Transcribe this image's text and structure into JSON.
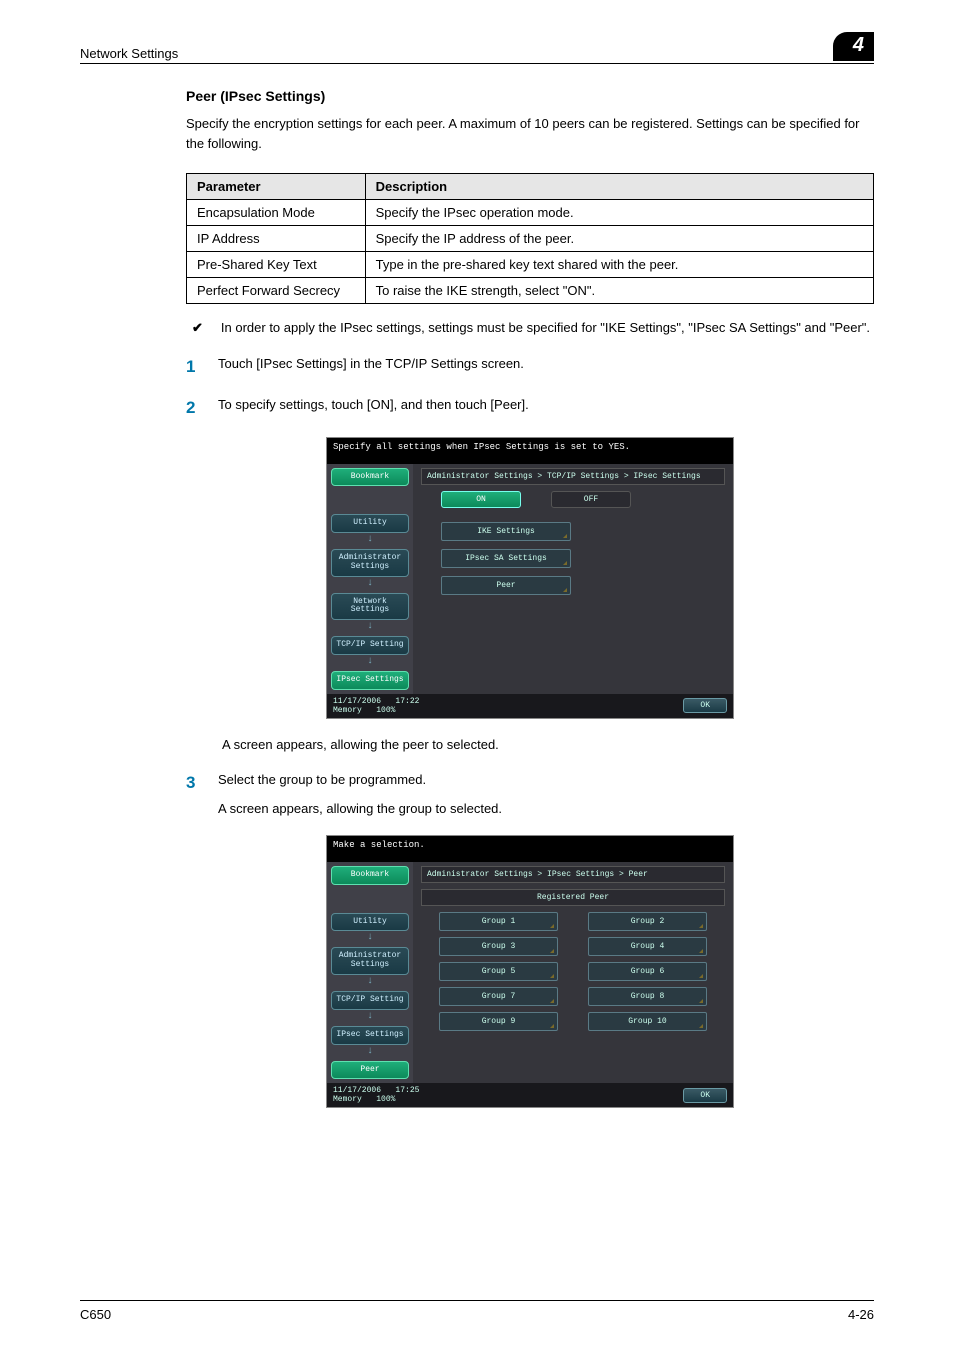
{
  "header": {
    "section": "Network Settings",
    "chapter": "4"
  },
  "h1": "Peer (IPsec Settings)",
  "intro": "Specify the encryption settings for each peer. A maximum of 10 peers can be registered. Settings can be specified for the following.",
  "table": {
    "headers": [
      "Parameter",
      "Description"
    ],
    "rows": [
      [
        "Encapsulation Mode",
        "Specify the IPsec operation mode."
      ],
      [
        "IP Address",
        "Specify the IP address of the peer."
      ],
      [
        "Pre-Shared Key Text",
        "Type in the pre-shared key text shared with the peer."
      ],
      [
        "Perfect Forward Secrecy",
        "To raise the IKE strength, select \"ON\"."
      ]
    ]
  },
  "note": "In order to apply the IPsec settings, settings must be specified for \"IKE Settings\", \"IPsec SA Settings\" and \"Peer\".",
  "steps": {
    "s1": "Touch [IPsec Settings] in the TCP/IP Settings screen.",
    "s2": "To specify settings, touch [ON], and then touch [Peer].",
    "s2_result": "A screen appears, allowing the peer to selected.",
    "s3": "Select the group to be programmed.",
    "s3_result": "A screen appears, allowing the group to selected."
  },
  "shot1": {
    "topmsg": "Specify all settings when IPsec Settings is set to YES.",
    "breadcrumb": "Administrator Settings > TCP/IP Settings > IPsec Settings",
    "on": "ON",
    "off": "OFF",
    "menus": [
      "IKE Settings",
      "IPsec SA Settings",
      "Peer"
    ],
    "side": {
      "bookmark": "Bookmark",
      "utility": "Utility",
      "admin": "Administrator\nSettings",
      "network": "Network\nSettings",
      "tcpip": "TCP/IP Setting",
      "ipsec": "IPsec Settings"
    },
    "footer": {
      "date": "11/17/2006",
      "time": "17:22",
      "mem_label": "Memory",
      "mem_val": "100%",
      "ok": "OK"
    }
  },
  "shot2": {
    "topmsg": "Make a selection.",
    "breadcrumb": "Administrator Settings > IPsec Settings > Peer",
    "groupheader": "Registered Peer",
    "groups": [
      "Group 1",
      "Group 2",
      "Group 3",
      "Group 4",
      "Group 5",
      "Group 6",
      "Group 7",
      "Group 8",
      "Group 9",
      "Group 10"
    ],
    "side": {
      "bookmark": "Bookmark",
      "utility": "Utility",
      "admin": "Administrator\nSettings",
      "tcpip": "TCP/IP Setting",
      "ipsec": "IPsec Settings",
      "peer": "Peer"
    },
    "footer": {
      "date": "11/17/2006",
      "time": "17:25",
      "mem_label": "Memory",
      "mem_val": "100%",
      "ok": "OK"
    }
  },
  "footer": {
    "left": "C650",
    "right": "4-26"
  }
}
